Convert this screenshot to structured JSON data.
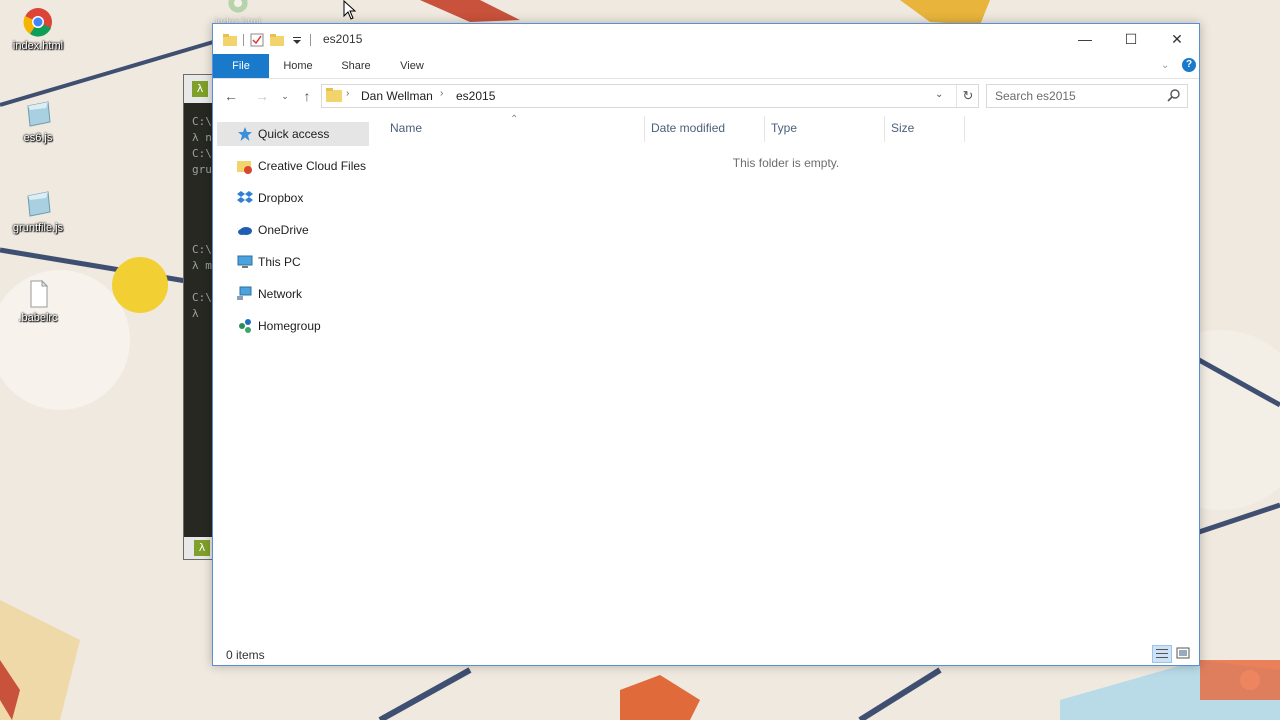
{
  "desktop": {
    "icons": [
      {
        "label": "index.html",
        "icon": "chrome-icon"
      },
      {
        "label": "es6.js",
        "icon": "js-file-icon"
      },
      {
        "label": "gruntfile.js",
        "icon": "js-file-icon"
      },
      {
        "label": ".babelrc",
        "icon": "file-icon"
      }
    ],
    "faded_icon_label": "index.html"
  },
  "terminal": {
    "lines": [
      "C:\\",
      "λ n",
      "C:\\",
      "gru",
      "C:\\",
      "λ m",
      "C:\\",
      "λ"
    ]
  },
  "explorer": {
    "title": "es2015",
    "caption": {
      "minimize": "—",
      "maximize": "☐",
      "close": "✕"
    },
    "ribbon_tabs": [
      {
        "label": "File",
        "active": true
      },
      {
        "label": "Home"
      },
      {
        "label": "Share"
      },
      {
        "label": "View"
      }
    ],
    "address": {
      "crumbs": [
        "Dan Wellman",
        "es2015"
      ]
    },
    "search": {
      "placeholder": "Search es2015"
    },
    "nav_pane": [
      {
        "label": "Quick access",
        "icon": "star-icon",
        "selected": true
      },
      {
        "label": "Creative Cloud Files",
        "icon": "creative-cloud-folder-icon"
      },
      {
        "label": "Dropbox",
        "icon": "dropbox-icon"
      },
      {
        "label": "OneDrive",
        "icon": "onedrive-icon"
      },
      {
        "label": "This PC",
        "icon": "computer-icon"
      },
      {
        "label": "Network",
        "icon": "network-icon"
      },
      {
        "label": "Homegroup",
        "icon": "homegroup-icon"
      }
    ],
    "columns": [
      "Name",
      "Date modified",
      "Type",
      "Size"
    ],
    "empty_message": "This folder is empty.",
    "status": {
      "item_count": "0 items"
    },
    "colors": {
      "accent": "#1979ca",
      "border": "#5b8fd4",
      "column_header": "#4c607a"
    }
  }
}
